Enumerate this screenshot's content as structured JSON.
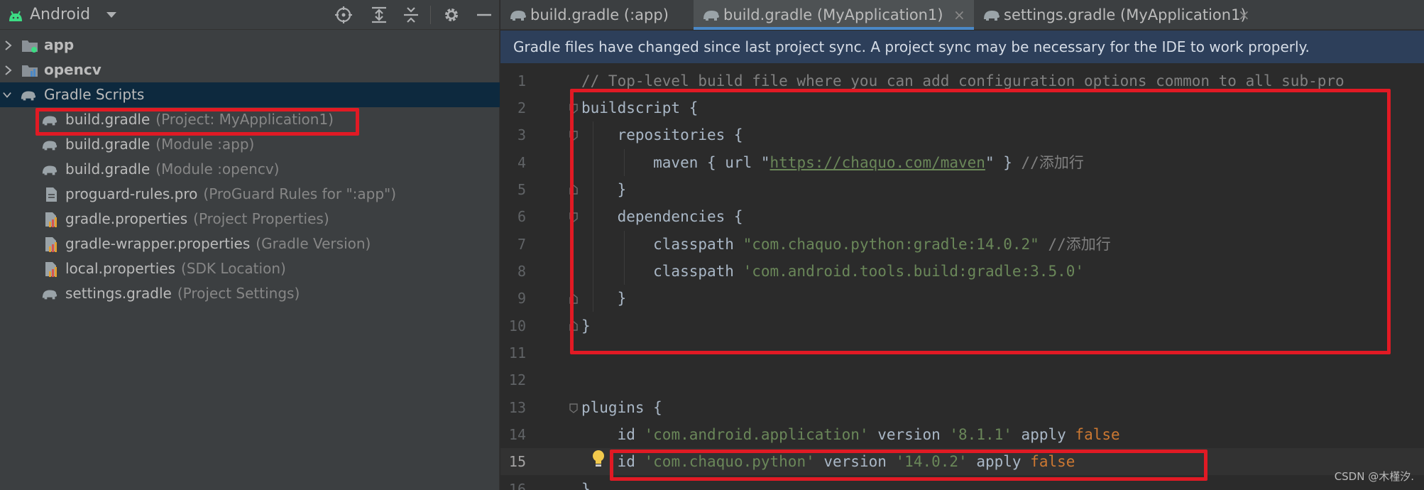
{
  "panel": {
    "title": "Android",
    "toolbar_icons": [
      "crosshair-icon",
      "expand-all-icon",
      "collapse-all-icon",
      "gear-icon",
      "minimize-icon"
    ]
  },
  "tree": [
    {
      "name": "app",
      "hint": ""
    },
    {
      "name": "opencv",
      "hint": ""
    },
    {
      "name": "Gradle Scripts",
      "hint": ""
    },
    {
      "name": "build.gradle",
      "hint": "(Project: MyApplication1)"
    },
    {
      "name": "build.gradle",
      "hint": "(Module :app)"
    },
    {
      "name": "build.gradle",
      "hint": "(Module :opencv)"
    },
    {
      "name": "proguard-rules.pro",
      "hint": "(ProGuard Rules for \":app\")"
    },
    {
      "name": "gradle.properties",
      "hint": "(Project Properties)"
    },
    {
      "name": "gradle-wrapper.properties",
      "hint": "(Gradle Version)"
    },
    {
      "name": "local.properties",
      "hint": "(SDK Location)"
    },
    {
      "name": "settings.gradle",
      "hint": "(Project Settings)"
    }
  ],
  "tabs": [
    {
      "label": "build.gradle (:app)"
    },
    {
      "label": "build.gradle (MyApplication1)"
    },
    {
      "label": "settings.gradle (MyApplication1)"
    }
  ],
  "tab_close": "×",
  "banner": "Gradle files have changed since last project sync. A project sync may be necessary for the IDE to work properly.",
  "line_numbers": [
    "1",
    "2",
    "3",
    "4",
    "5",
    "6",
    "7",
    "8",
    "9",
    "10",
    "11",
    "12",
    "13",
    "14",
    "15",
    "16"
  ],
  "code": {
    "l1": "// Top-level build file where you can add configuration options common to all sub-pro",
    "l2": "buildscript {",
    "l3a": "    repositories {",
    "l4a": "        maven { url \"",
    "l4url": "https://chaquo.com/maven",
    "l4b": "\" } ",
    "l4c": "//添加行",
    "l5": "    }",
    "l6": "    dependencies {",
    "l7a": "        classpath ",
    "l7s": "\"com.chaquo.python:gradle:14.0.2\"",
    "l7c": " //添加行",
    "l8a": "        classpath ",
    "l8s": "'com.android.tools.build:gradle:3.5.0'",
    "l9": "    }",
    "l10": "}",
    "l13": "plugins {",
    "l14a": "    id ",
    "l14s": "'com.android.application'",
    "l14b": " version ",
    "l14v": "'8.1.1'",
    "l14c": " apply ",
    "l14k": "false",
    "l15a": "    id ",
    "l15s": "'com.chaquo.python'",
    "l15b": " version ",
    "l15v": "'14.0.2'",
    "l15c": " apply ",
    "l15k": "false",
    "l16": "}"
  },
  "watermark": "CSDN @木槿汐.",
  "colors": {
    "highlight": "#e11a24",
    "selection": "#0d293e",
    "banner": "#2d3f5a"
  }
}
